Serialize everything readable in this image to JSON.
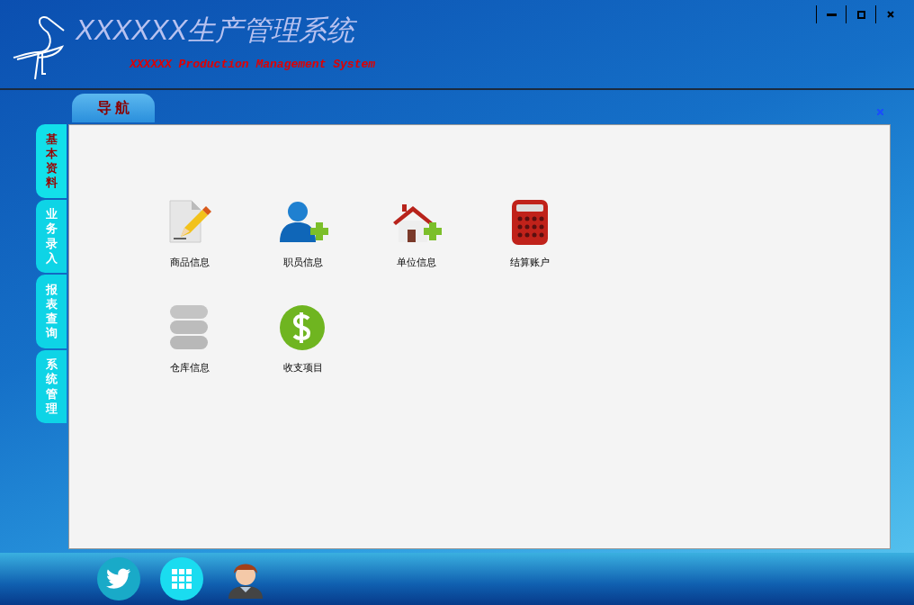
{
  "header": {
    "title": "XXXXXX生产管理系统",
    "subtitle": "XXXXXX Production Management System"
  },
  "nav_tab": {
    "label": "导 航"
  },
  "side_tabs": [
    {
      "label": "基本资料",
      "selected": true
    },
    {
      "label": "业务录入",
      "selected": false
    },
    {
      "label": "报表查询",
      "selected": false
    },
    {
      "label": "系统管理",
      "selected": false
    }
  ],
  "modules": [
    {
      "label": "商品信息"
    },
    {
      "label": "职员信息"
    },
    {
      "label": "单位信息"
    },
    {
      "label": "结算账户"
    },
    {
      "label": "仓库信息"
    },
    {
      "label": "收支项目"
    }
  ]
}
